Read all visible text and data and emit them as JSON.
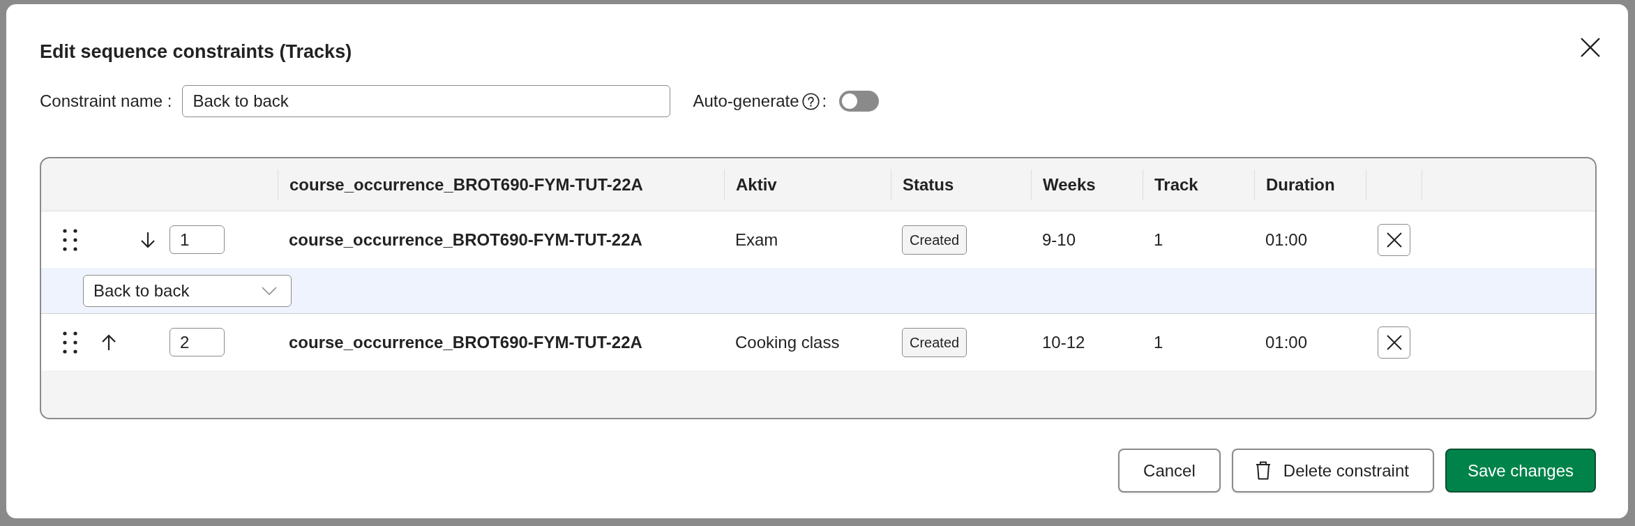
{
  "dialog": {
    "title": "Edit sequence constraints (Tracks)"
  },
  "constraint_name": {
    "label": "Constraint name :",
    "value": "Back to back"
  },
  "auto_generate": {
    "label": "Auto-generate",
    "suffix": ":",
    "on": false
  },
  "table": {
    "columns": [
      {
        "label": "course_occurrence_BROT690-FYM-TUT-22A",
        "kind": "bold"
      },
      {
        "label": "Aktiv",
        "kind": "text"
      },
      {
        "label": "Status",
        "kind": "badge"
      },
      {
        "label": "Weeks",
        "kind": "text"
      },
      {
        "label": "Track",
        "kind": "text"
      },
      {
        "label": "Duration",
        "kind": "text"
      }
    ],
    "rows": [
      {
        "order": "1",
        "can_move_up": false,
        "can_move_down": true,
        "cells": [
          "course_occurrence_BROT690-FYM-TUT-22A",
          "Exam",
          "Created",
          "9-10",
          "1",
          "01:00"
        ]
      },
      {
        "order": "2",
        "can_move_up": true,
        "can_move_down": false,
        "cells": [
          "course_occurrence_BROT690-FYM-TUT-22A",
          "Cooking class",
          "Created",
          "10-12",
          "1",
          "01:00"
        ]
      }
    ],
    "links": [
      {
        "value": "Back to back"
      }
    ]
  },
  "buttons": [
    {
      "label": "Cancel",
      "kind": "secondary"
    },
    {
      "label": "Delete constraint",
      "kind": "delete"
    },
    {
      "label": "Save changes",
      "kind": "primary"
    }
  ]
}
